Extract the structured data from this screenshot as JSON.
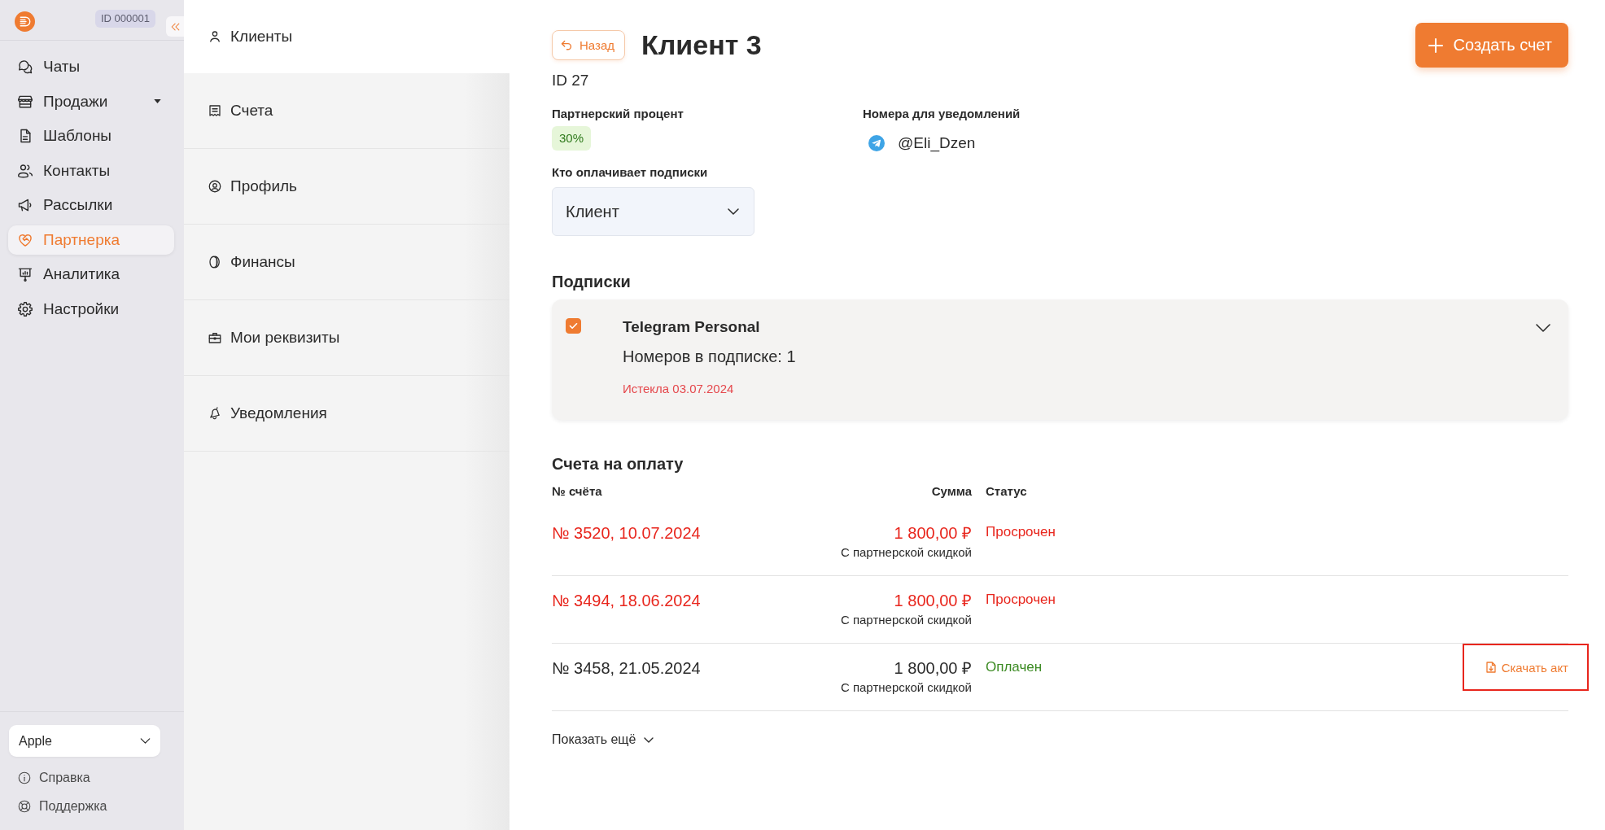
{
  "sidebar": {
    "account_id": "ID 000001",
    "items": [
      {
        "label": "Чаты",
        "kind": "link",
        "selected": false
      },
      {
        "label": "Продажи",
        "kind": "group",
        "selected": false
      },
      {
        "label": "Шаблоны",
        "kind": "link",
        "selected": false
      },
      {
        "label": "Контакты",
        "kind": "link",
        "selected": false
      },
      {
        "label": "Рассылки",
        "kind": "link",
        "selected": false
      },
      {
        "label": "Партнерка",
        "kind": "link",
        "selected": true
      },
      {
        "label": "Аналитика",
        "kind": "link",
        "selected": false
      },
      {
        "label": "Настройки",
        "kind": "link",
        "selected": false
      }
    ],
    "workspace": {
      "value": "Apple"
    },
    "footer_links": [
      {
        "label": "Справка"
      },
      {
        "label": "Поддержка"
      }
    ]
  },
  "sections": {
    "items": [
      {
        "label": "Клиенты",
        "selected": true
      },
      {
        "label": "Счета",
        "selected": false
      },
      {
        "label": "Профиль",
        "selected": false
      },
      {
        "label": "Финансы",
        "selected": false
      },
      {
        "label": "Мои реквизиты",
        "selected": false
      },
      {
        "label": "Уведомления",
        "selected": false
      }
    ]
  },
  "header": {
    "back_button": "Назад",
    "title": "Клиент 3",
    "create_button": "Создать счет",
    "client_id": "ID 27"
  },
  "partner_percent": {
    "label": "Партнерский процент",
    "value": "30%"
  },
  "notification_numbers": {
    "label": "Номера для уведомлений",
    "items": [
      {
        "handle": "@Eli_Dzen"
      }
    ]
  },
  "payer": {
    "label": "Кто оплачивает подписки",
    "value": "Клиент"
  },
  "subscriptions": {
    "title": "Подписки",
    "items": [
      {
        "name": "Telegram Personal",
        "numbers": "Номеров в подписке: 1",
        "status": "Истекла 03.07.2024",
        "expired": true,
        "checked": true,
        "expanded": false
      }
    ]
  },
  "invoices": {
    "title": "Счета на оплату",
    "columns": [
      "№ счёта",
      "Сумма",
      "Статус"
    ],
    "rows": [
      {
        "number": "№ 3520, 10.07.2024",
        "amount": "1 800,00 ₽",
        "note": "С партнерской скидкой",
        "status": "Просрочен",
        "kind": "overdue"
      },
      {
        "number": "№ 3494, 18.06.2024",
        "amount": "1 800,00 ₽",
        "note": "С партнерской скидкой",
        "status": "Просрочен",
        "kind": "overdue"
      },
      {
        "number": "№ 3458, 21.05.2024",
        "amount": "1 800,00 ₽",
        "note": "С партнерской скидкой",
        "status": "Оплачен",
        "kind": "paid",
        "action": {
          "label": "Скачать акт",
          "highlighted": true
        }
      }
    ],
    "show_more": "Показать ещё"
  }
}
